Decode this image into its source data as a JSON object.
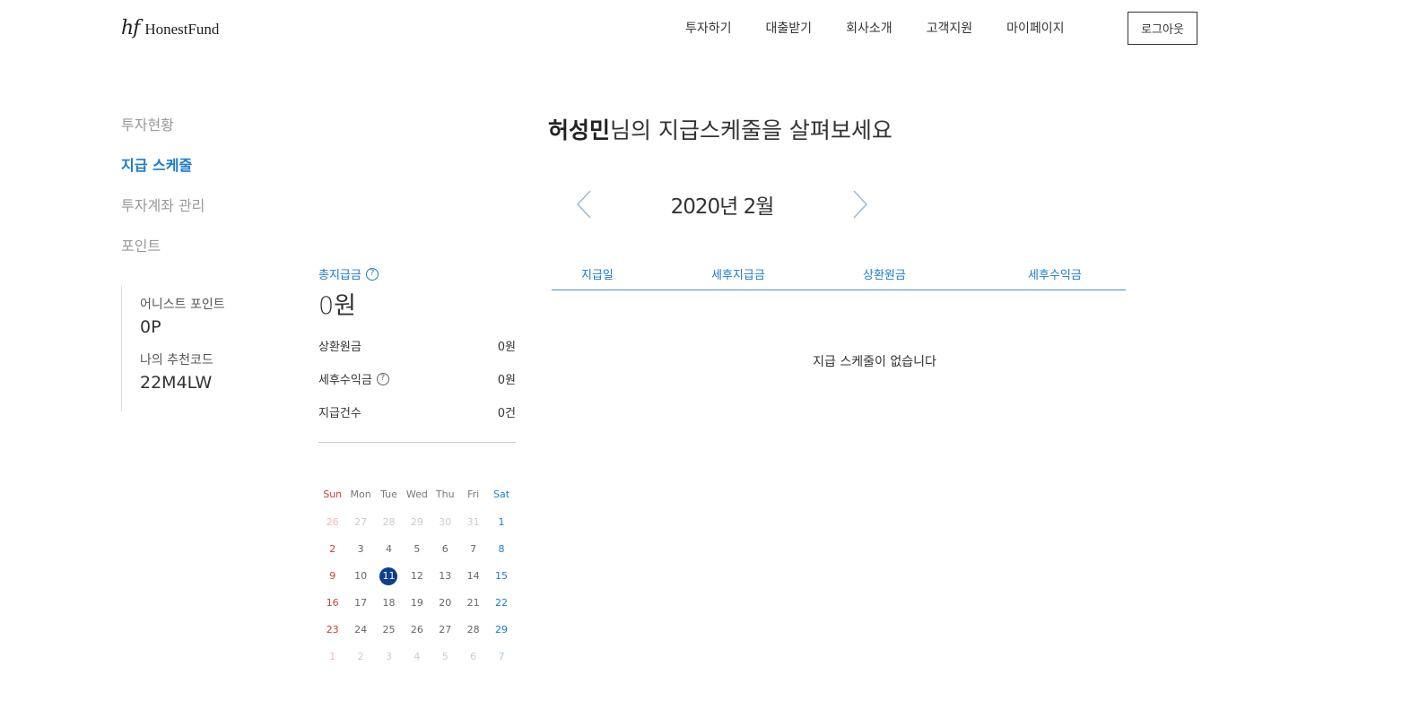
{
  "header": {
    "logo_mark": "hf",
    "logo_text": "HonestFund",
    "nav": [
      "투자하기",
      "대출받기",
      "회사소개",
      "고객지원",
      "마이페이지"
    ],
    "logout_label": "로그아웃"
  },
  "sidebar": {
    "items": [
      {
        "label": "투자현황"
      },
      {
        "label": "지급 스케줄"
      },
      {
        "label": "투자계좌 관리"
      },
      {
        "label": "포인트"
      }
    ],
    "points_label": "어니스트 포인트",
    "points_value": "0P",
    "referral_label": "나의 추천코드",
    "referral_value": "22M4LW"
  },
  "summary": {
    "total_label": "총지급금",
    "total_value": "0원",
    "rows": [
      {
        "label": "상환원금",
        "value": "0원"
      },
      {
        "label": "세후수익금",
        "value": "0원"
      },
      {
        "label": "지급건수",
        "value": "0건"
      }
    ]
  },
  "calendar": {
    "weekdays": [
      "Sun",
      "Mon",
      "Tue",
      "Wed",
      "Thu",
      "Fri",
      "Sat"
    ],
    "weeks": [
      [
        "26",
        "27",
        "28",
        "29",
        "30",
        "31",
        "1"
      ],
      [
        "2",
        "3",
        "4",
        "5",
        "6",
        "7",
        "8"
      ],
      [
        "9",
        "10",
        "11",
        "12",
        "13",
        "14",
        "15"
      ],
      [
        "16",
        "17",
        "18",
        "19",
        "20",
        "21",
        "22"
      ],
      [
        "23",
        "24",
        "25",
        "26",
        "27",
        "28",
        "29"
      ],
      [
        "1",
        "2",
        "3",
        "4",
        "5",
        "6",
        "7"
      ]
    ],
    "today": "11"
  },
  "main": {
    "title_name": "허성민",
    "title_rest": "님의 지급스케줄을 살펴보세요",
    "month_label": "2020년 2월",
    "columns": [
      "지급일",
      "세후지급금",
      "상환원금",
      "세후수익금"
    ],
    "empty_message": "지급 스케줄이 없습니다"
  },
  "colors": {
    "accent": "#1a7bd1",
    "today_bg": "#0d3d8c",
    "sunday": "#d23a3a"
  }
}
